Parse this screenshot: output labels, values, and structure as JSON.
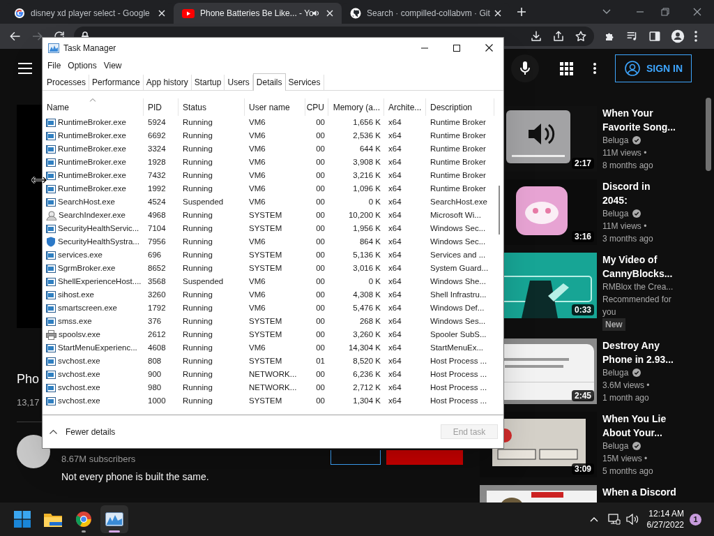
{
  "browser": {
    "tabs": [
      {
        "title": "disney xd player select - Google",
        "kind": "google",
        "selected": false,
        "audio": false
      },
      {
        "title": "Phone Batteries Be Like... - Yo",
        "kind": "youtube",
        "selected": true,
        "audio": true
      },
      {
        "title": "Search · compilled-collabvm · Git",
        "kind": "github",
        "selected": false,
        "audio": false
      }
    ]
  },
  "youtube": {
    "sign_in": "SIGN IN",
    "video_title": "Pho",
    "views": "13,17",
    "subscribers": "8.67M subscribers",
    "description": "Not every phone is built the same.",
    "recommendations": [
      {
        "duration": "2:17",
        "title_lines": [
          "When Your",
          "Favorite Song..."
        ],
        "channel": "Beluga",
        "verified": true,
        "meta_lines": [
          "11M views •",
          "8 months ago"
        ]
      },
      {
        "duration": "3:16",
        "title_lines": [
          "Discord in",
          "2045:"
        ],
        "channel": "Beluga",
        "verified": true,
        "meta_lines": [
          "11M views •",
          "3 months ago"
        ]
      },
      {
        "duration": "0:33",
        "title_lines": [
          "My Video of",
          "CannyBlocks..."
        ],
        "channel": "RMBlox the Crea...",
        "verified": false,
        "meta_lines": [
          "Recommended for",
          "you"
        ],
        "badge": "New"
      },
      {
        "duration": "2:45",
        "title_lines": [
          "Destroy Any",
          "Phone in 2.93..."
        ],
        "channel": "Beluga",
        "verified": true,
        "meta_lines": [
          "3.6M views •",
          "1 month ago"
        ]
      },
      {
        "duration": "3:09",
        "title_lines": [
          "When You Lie",
          "About Your..."
        ],
        "channel": "Beluga",
        "verified": true,
        "meta_lines": [
          "15M views •",
          "5 months ago"
        ]
      },
      {
        "title_lines": [
          "When a Discord"
        ]
      }
    ]
  },
  "task_manager": {
    "title": "Task Manager",
    "menu": [
      "File",
      "Options",
      "View"
    ],
    "tabs": [
      {
        "label": "Processes",
        "selected": false
      },
      {
        "label": "Performance",
        "selected": false
      },
      {
        "label": "App history",
        "selected": false
      },
      {
        "label": "Startup",
        "selected": false
      },
      {
        "label": "Users",
        "selected": false
      },
      {
        "label": "Details",
        "selected": true
      },
      {
        "label": "Services",
        "selected": false
      }
    ],
    "columns": [
      {
        "label": "Name",
        "sorted": true
      },
      {
        "label": "PID",
        "sorted": false
      },
      {
        "label": "Status",
        "sorted": false
      },
      {
        "label": "User name",
        "sorted": false
      },
      {
        "label": "CPU",
        "sorted": false
      },
      {
        "label": "Memory (a...",
        "sorted": false
      },
      {
        "label": "Archite...",
        "sorted": false
      },
      {
        "label": "Description",
        "sorted": false
      }
    ],
    "rows": [
      {
        "kind": "app",
        "cells": [
          "RuntimeBroker.exe",
          "5924",
          "Running",
          "VM6",
          "00",
          "1,656 K",
          "x64",
          "Runtime Broker"
        ]
      },
      {
        "kind": "app",
        "cells": [
          "RuntimeBroker.exe",
          "6692",
          "Running",
          "VM6",
          "00",
          "2,536 K",
          "x64",
          "Runtime Broker"
        ]
      },
      {
        "kind": "app",
        "cells": [
          "RuntimeBroker.exe",
          "3324",
          "Running",
          "VM6",
          "00",
          "644 K",
          "x64",
          "Runtime Broker"
        ]
      },
      {
        "kind": "app",
        "cells": [
          "RuntimeBroker.exe",
          "1928",
          "Running",
          "VM6",
          "00",
          "3,908 K",
          "x64",
          "Runtime Broker"
        ]
      },
      {
        "kind": "app",
        "cells": [
          "RuntimeBroker.exe",
          "7432",
          "Running",
          "VM6",
          "00",
          "3,216 K",
          "x64",
          "Runtime Broker"
        ]
      },
      {
        "kind": "app",
        "cells": [
          "RuntimeBroker.exe",
          "1992",
          "Running",
          "VM6",
          "00",
          "1,096 K",
          "x64",
          "Runtime Broker"
        ]
      },
      {
        "kind": "app",
        "cells": [
          "SearchHost.exe",
          "4524",
          "Suspended",
          "VM6",
          "00",
          "0 K",
          "x64",
          "SearchHost.exe"
        ]
      },
      {
        "kind": "indexer",
        "cells": [
          "SearchIndexer.exe",
          "4968",
          "Running",
          "SYSTEM",
          "00",
          "10,200 K",
          "x64",
          "Microsoft Wi..."
        ]
      },
      {
        "kind": "app",
        "cells": [
          "SecurityHealthServic...",
          "7104",
          "Running",
          "SYSTEM",
          "00",
          "1,956 K",
          "x64",
          "Windows Sec..."
        ]
      },
      {
        "kind": "shield",
        "cells": [
          "SecurityHealthSystra...",
          "7956",
          "Running",
          "VM6",
          "00",
          "864 K",
          "x64",
          "Windows Sec..."
        ]
      },
      {
        "kind": "app",
        "cells": [
          "services.exe",
          "696",
          "Running",
          "SYSTEM",
          "00",
          "5,136 K",
          "x64",
          "Services and ..."
        ]
      },
      {
        "kind": "app",
        "cells": [
          "SgrmBroker.exe",
          "8652",
          "Running",
          "SYSTEM",
          "00",
          "3,016 K",
          "x64",
          "System Guard..."
        ]
      },
      {
        "kind": "app",
        "cells": [
          "ShellExperienceHost....",
          "3568",
          "Suspended",
          "VM6",
          "00",
          "0 K",
          "x64",
          "Windows She..."
        ]
      },
      {
        "kind": "app",
        "cells": [
          "sihost.exe",
          "3260",
          "Running",
          "VM6",
          "00",
          "4,308 K",
          "x64",
          "Shell Infrastru..."
        ]
      },
      {
        "kind": "app",
        "cells": [
          "smartscreen.exe",
          "1792",
          "Running",
          "VM6",
          "00",
          "5,476 K",
          "x64",
          "Windows Def..."
        ]
      },
      {
        "kind": "app",
        "cells": [
          "smss.exe",
          "376",
          "Running",
          "SYSTEM",
          "00",
          "268 K",
          "x64",
          "Windows Ses..."
        ]
      },
      {
        "kind": "printer",
        "cells": [
          "spoolsv.exe",
          "2612",
          "Running",
          "SYSTEM",
          "00",
          "3,260 K",
          "x64",
          "Spooler SubS..."
        ]
      },
      {
        "kind": "app",
        "cells": [
          "StartMenuExperienc...",
          "4608",
          "Running",
          "VM6",
          "00",
          "14,304 K",
          "x64",
          "StartMenuEx..."
        ]
      },
      {
        "kind": "app",
        "cells": [
          "svchost.exe",
          "808",
          "Running",
          "SYSTEM",
          "01",
          "8,520 K",
          "x64",
          "Host Process ..."
        ]
      },
      {
        "kind": "app",
        "cells": [
          "svchost.exe",
          "900",
          "Running",
          "NETWORK...",
          "00",
          "6,236 K",
          "x64",
          "Host Process ..."
        ]
      },
      {
        "kind": "app",
        "cells": [
          "svchost.exe",
          "980",
          "Running",
          "NETWORK...",
          "00",
          "2,712 K",
          "x64",
          "Host Process ..."
        ]
      },
      {
        "kind": "app",
        "cells": [
          "svchost.exe",
          "1000",
          "Running",
          "SYSTEM",
          "00",
          "1,304 K",
          "x64",
          "Host Process ..."
        ]
      }
    ],
    "fewer_details": "Fewer details",
    "end_task": {
      "label": "End task",
      "disabled": true
    }
  },
  "taskbar": {
    "apps": [
      {
        "kind": "start",
        "selected": false,
        "running": false
      },
      {
        "kind": "folder",
        "selected": false,
        "running": false
      },
      {
        "kind": "chrome",
        "selected": false,
        "running": true
      },
      {
        "kind": "taskmgr",
        "selected": true,
        "running": true
      }
    ],
    "time": "12:14 AM",
    "date": "6/27/2022",
    "notifications": "1"
  }
}
